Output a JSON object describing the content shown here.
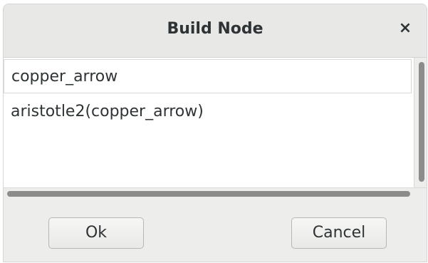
{
  "dialog": {
    "title": "Build Node",
    "close_label": "×"
  },
  "list": {
    "items": [
      {
        "label": "copper_arrow",
        "selected": true
      },
      {
        "label": "aristotle2(copper_arrow)",
        "selected": false
      }
    ]
  },
  "buttons": {
    "ok_label": "Ok",
    "cancel_label": "Cancel"
  }
}
